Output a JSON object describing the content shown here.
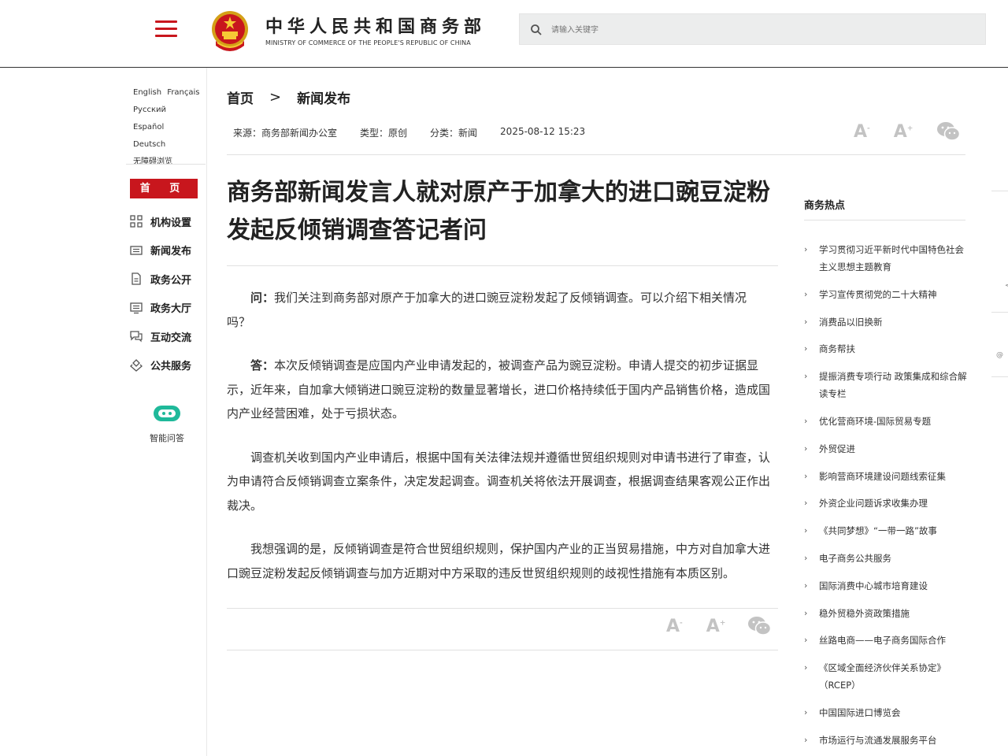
{
  "header": {
    "site_name_cn": "中华人民共和国商务部",
    "site_name_en": "MINISTRY OF COMMERCE OF THE PEOPLE'S REPUBLIC OF CHINA",
    "search_placeholder": "请输入关键字",
    "menu_icon": "hamburger-menu-icon",
    "emblem_icon": "national-emblem-icon",
    "brand_color": "#c8161d"
  },
  "sidebar": {
    "languages": [
      "English",
      "Français",
      "Русский",
      "Español",
      "Deutsch"
    ],
    "accessibility": "无障碍浏览",
    "home": "首  页",
    "items": [
      {
        "label": "机构设置",
        "icon": "org-grid-icon"
      },
      {
        "label": "新闻发布",
        "icon": "news-icon"
      },
      {
        "label": "政务公开",
        "icon": "document-icon"
      },
      {
        "label": "政务大厅",
        "icon": "hall-monitor-icon"
      },
      {
        "label": "互动交流",
        "icon": "chat-icon"
      },
      {
        "label": "公共服务",
        "icon": "service-icon"
      }
    ],
    "ai_label": "智能问答"
  },
  "breadcrumb": {
    "home": "首页",
    "separator": ">",
    "current": "新闻发布"
  },
  "meta": {
    "source": "来源：商务部新闻办公室",
    "type": "类型：原创",
    "category": "分类：新闻",
    "datetime": "2025-08-12 15:23"
  },
  "tools": {
    "font_small": "A",
    "font_large": "A",
    "share_icon": "wechat-icon"
  },
  "article": {
    "title": "商务部新闻发言人就对原产于加拿大的进口豌豆淀粉发起反倾销调查答记者问",
    "paragraphs": [
      {
        "lead": "问：",
        "text": "我们关注到商务部对原产于加拿大的进口豌豆淀粉发起了反倾销调查。可以介绍下相关情况吗？"
      },
      {
        "lead": "答：",
        "text": "本次反倾销调查是应国内产业申请发起的，被调查产品为豌豆淀粉。申请人提交的初步证据显示，近年来，自加拿大倾销进口豌豆淀粉的数量显著增长，进口价格持续低于国内产品销售价格，造成国内产业经营困难，处于亏损状态。"
      },
      {
        "lead": "",
        "text": "调查机关收到国内产业申请后，根据中国有关法律法规并遵循世贸组织规则对申请书进行了审查，认为申请符合反倾销调查立案条件，决定发起调查。调查机关将依法开展调查，根据调查结果客观公正作出裁决。"
      },
      {
        "lead": "",
        "text": "我想强调的是，反倾销调查是符合世贸组织规则，保护国内产业的正当贸易措施，中方对自加拿大进口豌豆淀粉发起反倾销调查与加方近期对中方采取的违反世贸组织规则的歧视性措施有本质区别。"
      }
    ]
  },
  "hot": {
    "title": "商务热点",
    "items": [
      "学习贯彻习近平新时代中国特色社会主义思想主题教育",
      "学习宣传贯彻党的二十大精神",
      "消费品以旧换新",
      "商务帮扶",
      "提振消费专项行动 政策集成和综合解读专栏",
      "优化营商环境-国际贸易专题",
      "外贸促进",
      "影响营商环境建设问题线索征集",
      "外资企业问题诉求收集办理",
      "《共同梦想》“一带一路”故事",
      "电子商务公共服务",
      "国际消费中心城市培育建设",
      "稳外贸稳外资政策措施",
      "丝路电商——电子商务国际合作",
      "《区域全面经济伙伴关系协定》（RCEP）",
      "中国国际进口博览会",
      "市场运行与流通发展服务平台"
    ]
  },
  "edge": {
    "mark1": "@",
    "mark2": "<"
  }
}
